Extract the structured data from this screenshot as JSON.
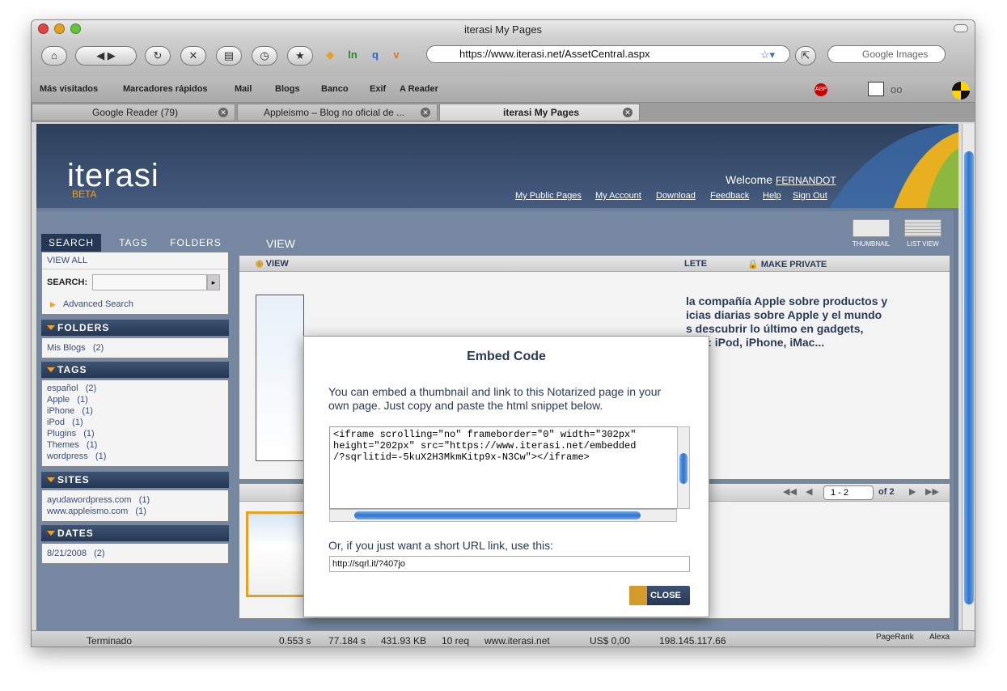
{
  "window": {
    "title": "iterasi My Pages"
  },
  "toolbar": {
    "url": "https://www.iterasi.net/AssetCentral.aspx",
    "search_placeholder": "Google Images"
  },
  "bookmarks": [
    {
      "label": "Más visitados"
    },
    {
      "label": "Marcadores rápidos"
    },
    {
      "label": "Mail"
    },
    {
      "label": "Blogs"
    },
    {
      "label": "Banco"
    },
    {
      "label": "Exif"
    },
    {
      "label": "A Reader"
    }
  ],
  "tabs": [
    {
      "label": "Google Reader (79)"
    },
    {
      "label": "Appleismo – Blog no oficial de ..."
    },
    {
      "label": "iterasi My Pages"
    }
  ],
  "site": {
    "logo": "iterasi",
    "beta": "BETA",
    "welcome": "Welcome",
    "user": "FERNANDOT",
    "links": [
      "My Public Pages",
      "My Account",
      "Download",
      "Feedback",
      "Help",
      "Sign Out"
    ],
    "views": {
      "thumbnail": "THUMBNAIL",
      "list": "LIST VIEW"
    }
  },
  "sidebar": {
    "tabs": [
      "SEARCH",
      "TAGS",
      "FOLDERS"
    ],
    "view_all": "VIEW ALL",
    "search_label": "SEARCH:",
    "advanced": "Advanced Search",
    "folders": {
      "title": "FOLDERS",
      "items": [
        "Mis Blogs   (2)"
      ]
    },
    "tags": {
      "title": "TAGS",
      "items": [
        "español   (2)",
        "Apple   (1)",
        "iPhone   (1)",
        "iPod   (1)",
        "Plugins   (1)",
        "Themes   (1)",
        "wordpress   (1)"
      ]
    },
    "sites": {
      "title": "SITES",
      "items": [
        "ayudawordpress.com   (1)",
        "www.appleismo.com   (1)"
      ]
    },
    "dates": {
      "title": "DATES",
      "items": [
        "8/21/2008   (2)"
      ]
    }
  },
  "main": {
    "view_label": "VIEW",
    "toolbar_view": "VIEW",
    "toolbar_delete": "LETE",
    "toolbar_private": "MAKE PRIVATE",
    "description": "la compañía Apple sobre productos y\nicias diarias sobre Apple y el mundo\ns descubrir lo último en gadgets,\nPLE: iPod, iPhone, iMac...",
    "pager": {
      "range": "1 - 2",
      "of": "of 2"
    }
  },
  "modal": {
    "title": "Embed Code",
    "intro": "You can embed a thumbnail and link to this Notarized page in your own page. Just copy and paste the html snippet below.",
    "code": "<iframe scrolling=\"no\" frameborder=\"0\" width=\"302px\"\nheight=\"202px\" src=\"https://www.iterasi.net/embedded\n/?sqrlitid=-5kuX2H3MkmKitp9x-N3Cw\"></iframe>",
    "short_label": "Or, if you just want a short URL link, use this:",
    "short_url": "http://sqrl.it/?407jo",
    "close": "CLOSE"
  },
  "status": {
    "text": "Terminado",
    "t1": "0.553 s",
    "t2": "77.184 s",
    "size": "431.93 KB",
    "req": "10 req",
    "host": "www.iterasi.net",
    "money": "US$ 0,00",
    "ip": "198.145.117.66",
    "pagerank": "PageRank",
    "alexa": "Alexa"
  }
}
